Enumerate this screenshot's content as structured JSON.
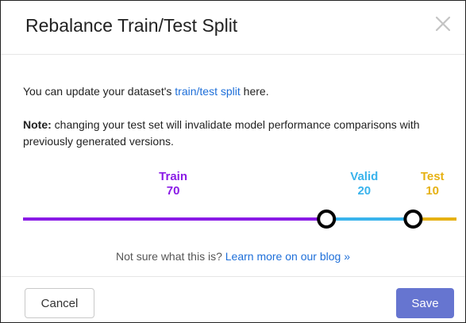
{
  "dialog": {
    "title": "Rebalance Train/Test Split",
    "close_symbol": "×"
  },
  "intro": {
    "before_link": "You can update your dataset's ",
    "link": "train/test split",
    "after_link": " here."
  },
  "note": {
    "label": "Note:",
    "text": " changing your test set will invalidate model performance comparisons with previously generated versions."
  },
  "split": {
    "train": {
      "name": "Train",
      "value": "70",
      "percent": 70,
      "color": "#8a1be6"
    },
    "valid": {
      "name": "Valid",
      "value": "20",
      "percent": 20,
      "color": "#39b3ec"
    },
    "test": {
      "name": "Test",
      "value": "10",
      "percent": 10,
      "color": "#e6b113"
    }
  },
  "help": {
    "text": "Not sure what this is? ",
    "link": "Learn more on our blog",
    "link_icon": "»"
  },
  "footer": {
    "cancel_label": "Cancel",
    "save_label": "Save"
  },
  "icons": {
    "close": "close-icon",
    "blog_link": "double-chevron-right-icon",
    "handle": "slider-handle-icon"
  },
  "colors": {
    "link": "#1e6fd9",
    "save_button": "#6675d0"
  }
}
